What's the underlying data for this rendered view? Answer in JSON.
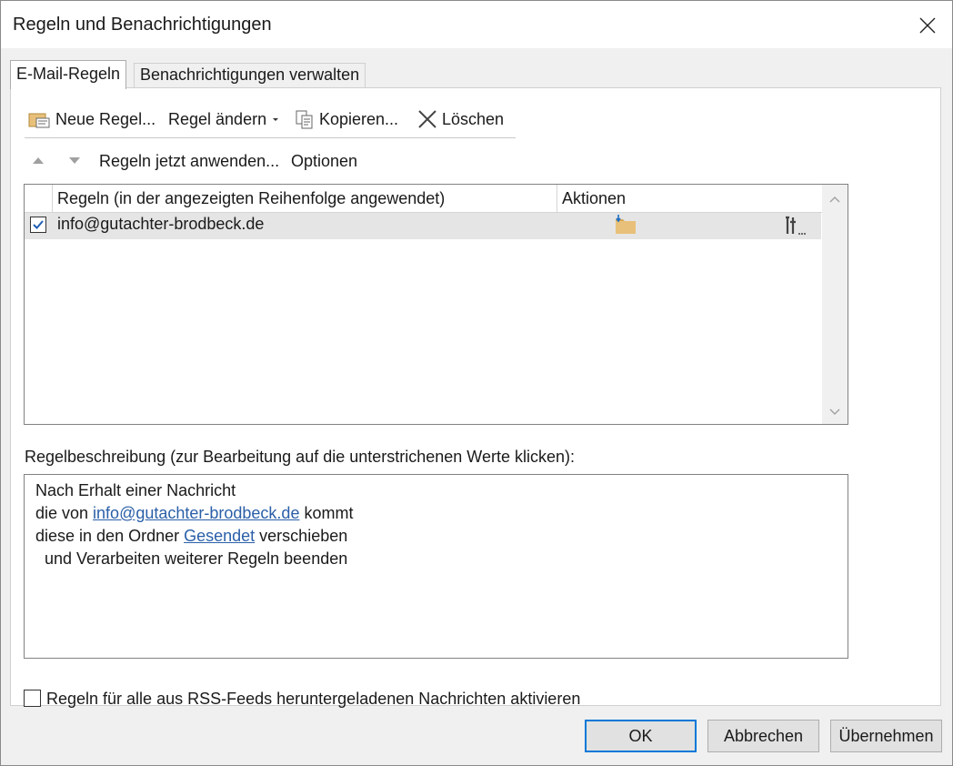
{
  "window": {
    "title": "Regeln und Benachrichtigungen"
  },
  "tabs": [
    {
      "label": "E-Mail-Regeln",
      "active": true
    },
    {
      "label": "Benachrichtigungen verwalten",
      "active": false
    }
  ],
  "toolbar": {
    "new_rule": "Neue Regel...",
    "change_rule": "Regel ändern",
    "copy": "Kopieren...",
    "delete": "Löschen",
    "apply_now": "Regeln jetzt anwenden...",
    "options": "Optionen"
  },
  "rules_table": {
    "columns": [
      "Regeln (in der angezeigten Reihenfolge angewendet)",
      "Aktionen"
    ],
    "rows": [
      {
        "checked": true,
        "name": "info@gutachter-brodbeck.de",
        "action_icon": "move-to-folder-icon",
        "extra_icon": "tools-icon"
      }
    ]
  },
  "description": {
    "label": "Regelbeschreibung (zur Bearbeitung auf die unterstrichenen Werte klicken):",
    "line1": "Nach Erhalt einer Nachricht",
    "line2_prefix": "die von ",
    "line2_link": "info@gutachter-brodbeck.de",
    "line2_suffix": " kommt",
    "line3_prefix": "diese in den Ordner ",
    "line3_link": "Gesendet",
    "line3_suffix": " verschieben",
    "line4": "und Verarbeiten weiterer Regeln beenden"
  },
  "rss": {
    "label": "Regeln für alle aus RSS-Feeds heruntergeladenen Nachrichten aktivieren",
    "checked": false
  },
  "buttons": {
    "ok": "OK",
    "cancel": "Abbrechen",
    "apply": "Übernehmen"
  },
  "colors": {
    "link": "#2a5fa8",
    "default_button_border": "#0078d7",
    "selected_row": "#e5e5e5"
  }
}
